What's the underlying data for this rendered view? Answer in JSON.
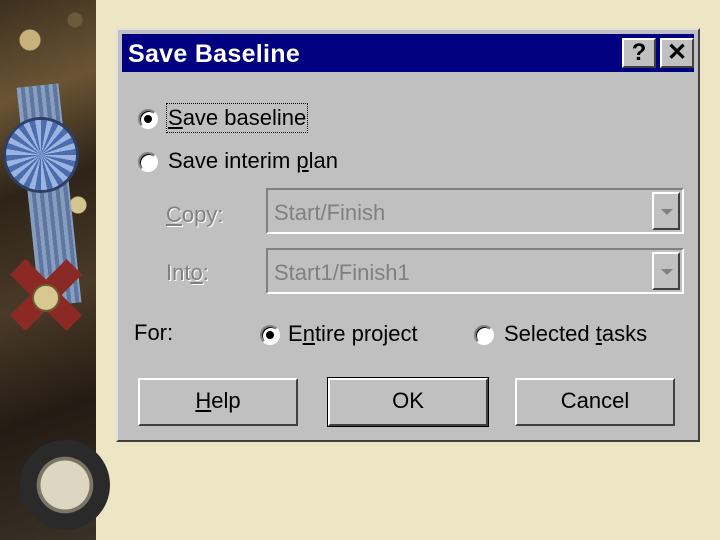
{
  "dialog": {
    "title": "Save Baseline",
    "help_icon_glyph": "?",
    "close_icon_glyph": "✕"
  },
  "options": {
    "save_baseline": {
      "pre": "",
      "key": "S",
      "post": "ave baseline",
      "checked": true
    },
    "save_interim": {
      "pre": "Save interim ",
      "key": "p",
      "post": "lan",
      "checked": false
    }
  },
  "copy": {
    "pre": "",
    "key": "C",
    "post": "opy:",
    "value": "Start/Finish",
    "disabled": true
  },
  "into": {
    "pre": "Int",
    "key": "o",
    "post": ":",
    "value": "Start1/Finish1",
    "disabled": true
  },
  "for": {
    "label": "For:",
    "entire": {
      "pre": "E",
      "key": "n",
      "post": "tire project",
      "checked": true
    },
    "selected": {
      "pre": "Selected ",
      "key": "t",
      "post": "asks",
      "checked": false
    }
  },
  "buttons": {
    "help": {
      "pre": "",
      "key": "H",
      "post": "elp"
    },
    "ok": "OK",
    "cancel": "Cancel"
  },
  "icons": [
    "help-icon",
    "close-icon",
    "dropdown-arrow-icon"
  ]
}
